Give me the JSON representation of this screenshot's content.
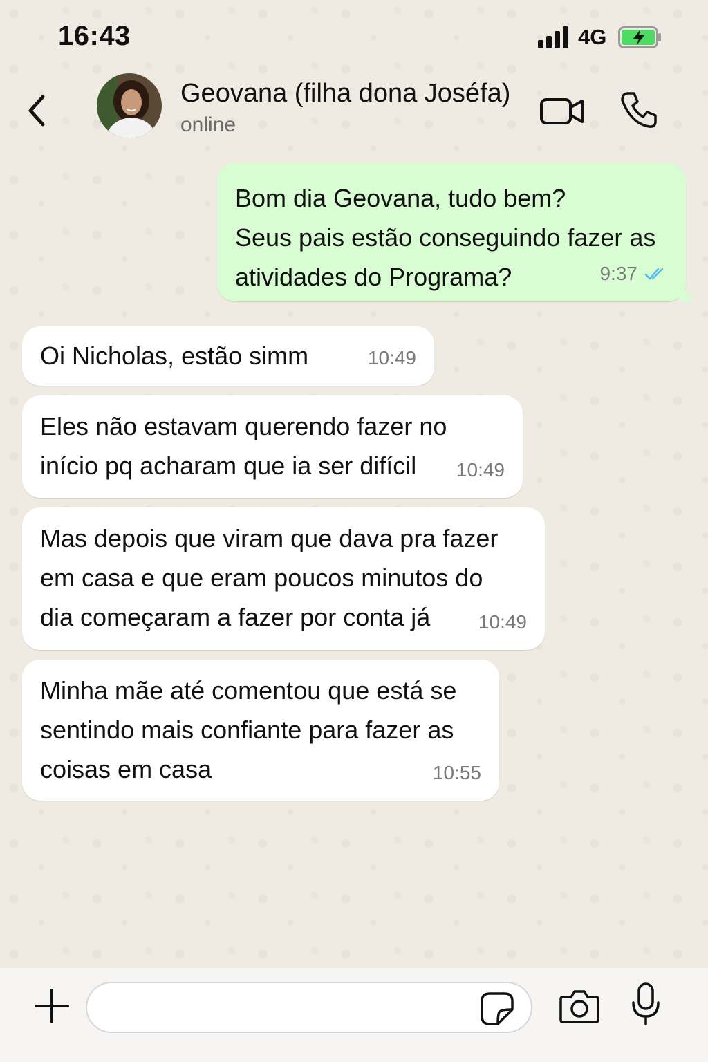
{
  "status_bar": {
    "time": "16:43",
    "network": "4G"
  },
  "header": {
    "contact_name": "Geovana (filha dona Joséfa)",
    "status": "online"
  },
  "messages": [
    {
      "direction": "out",
      "text": "Bom dia Geovana, tudo bem?\nSeus pais estão conseguindo fazer as\natividades do Programa?",
      "time": "9:37",
      "read": true
    },
    {
      "direction": "in",
      "text": "Oi Nicholas, estão simm",
      "time": "10:49"
    },
    {
      "direction": "in",
      "text": "Eles não estavam querendo fazer no\ninício pq acharam que ia ser difícil",
      "time": "10:49"
    },
    {
      "direction": "in",
      "text": "Mas depois que viram que dava pra fazer\nem casa e que eram poucos minutos do\ndia começaram a fazer por conta já",
      "time": "10:49"
    },
    {
      "direction": "in",
      "text": "Minha mãe até comentou que está se\nsentindo mais confiante para fazer as\ncoisas em casa",
      "time": "10:55"
    }
  ],
  "composer": {
    "value": "",
    "placeholder": ""
  },
  "colors": {
    "outgoing_bubble": "#d9fdd3",
    "incoming_bubble": "#ffffff",
    "read_ticks": "#53bdeb",
    "battery_fill": "#4cd964"
  },
  "icons": [
    "back-icon",
    "video-call-icon",
    "phone-icon",
    "plus-icon",
    "sticker-icon",
    "camera-icon",
    "mic-icon",
    "signal-icon",
    "battery-charging-icon",
    "read-ticks-icon"
  ]
}
